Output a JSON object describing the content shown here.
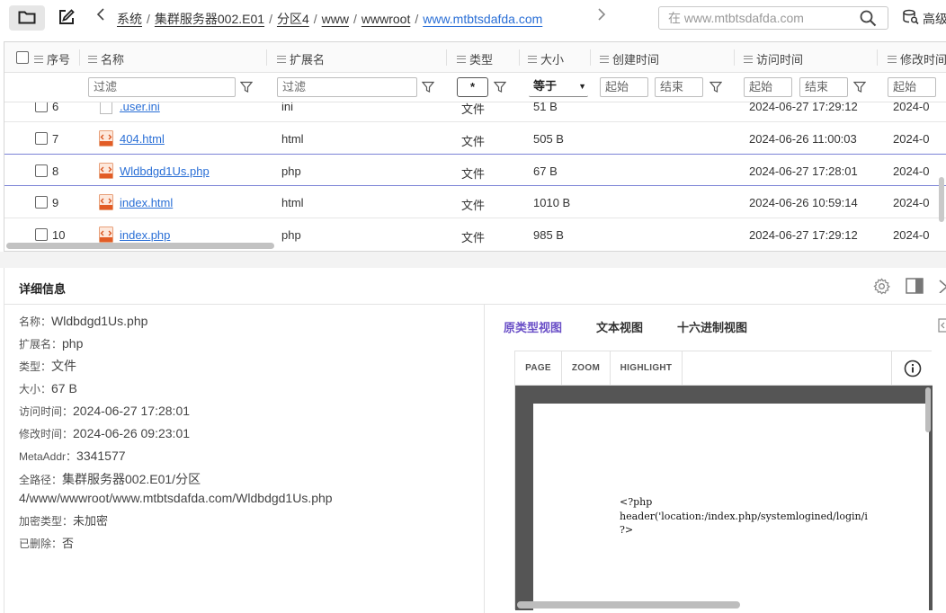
{
  "toolbar": {
    "folder_icon": "folder-icon",
    "edit_icon": "edit-icon",
    "back_icon": "chevron-left-icon",
    "forward_icon": "chevron-right-icon"
  },
  "breadcrumb": [
    "系统",
    "集群服务器002.E01",
    "分区4",
    "www",
    "wwwroot",
    "www.mtbtsdafda.com"
  ],
  "search": {
    "placeholder": "在 www.mtbtsdafda.com"
  },
  "advanced_label": "高级",
  "table": {
    "headers": {
      "index": "序号",
      "name": "名称",
      "ext": "扩展名",
      "type": "类型",
      "size": "大小",
      "created": "创建时间",
      "accessed": "访问时间",
      "modified": "修改时间"
    },
    "filters": {
      "name": "过滤",
      "ext": "过滤",
      "type": "*",
      "size_op": "等于",
      "created_start": "起始",
      "created_end": "结束",
      "accessed_start": "起始",
      "accessed_end": "结束",
      "modified_start": "起始"
    },
    "rows": [
      {
        "index": "6",
        "name": ".user.ini",
        "ext": "ini",
        "type": "文件",
        "size": "51 B",
        "accessed": "2024-06-27 17:29:12",
        "modified": "2024-0",
        "icon": "file-icon"
      },
      {
        "index": "7",
        "name": "404.html",
        "ext": "html",
        "type": "文件",
        "size": "505 B",
        "accessed": "2024-06-26 11:00:03",
        "modified": "2024-0",
        "icon": "html-file-icon"
      },
      {
        "index": "8",
        "name": "Wldbdgd1Us.php",
        "ext": "php",
        "type": "文件",
        "size": "67 B",
        "accessed": "2024-06-27 17:28:01",
        "modified": "2024-0",
        "icon": "html-file-icon"
      },
      {
        "index": "9",
        "name": "index.html",
        "ext": "html",
        "type": "文件",
        "size": "1010 B",
        "accessed": "2024-06-26 10:59:14",
        "modified": "2024-0",
        "icon": "html-file-icon"
      },
      {
        "index": "10",
        "name": "index.php",
        "ext": "php",
        "type": "文件",
        "size": "985 B",
        "accessed": "2024-06-27 17:29:12",
        "modified": "2024-0",
        "icon": "html-file-icon"
      }
    ]
  },
  "details": {
    "title": "详细信息",
    "fields": [
      {
        "label": "名称：",
        "value": "Wldbdgd1Us.php"
      },
      {
        "label": "扩展名：",
        "value": "php"
      },
      {
        "label": "类型：",
        "value": "文件"
      },
      {
        "label": "大小：",
        "value": "67 B"
      },
      {
        "label": "访问时间：",
        "value": "2024-06-27 17:28:01"
      },
      {
        "label": "修改时间：",
        "value": "2024-06-26 09:23:01"
      },
      {
        "label": "MetaAddr：",
        "value": "3341577"
      }
    ],
    "path_label": "全路径：",
    "path_value": "集群服务器002.E01/分区4/www/wwwroot/www.mtbtsdafda.com/Wldbdgd1Us.php",
    "encrypt_label": "加密类型：",
    "encrypt_value": "未加密",
    "deleted_label": "已删除：",
    "deleted_value": "否"
  },
  "viewer": {
    "tabs": [
      "原类型视图",
      "文本视图",
      "十六进制视图"
    ],
    "active_tab": 0,
    "buttons": [
      "PAGE",
      "ZOOM",
      "HIGHLIGHT"
    ],
    "code_lines": [
      "<?php",
      "header('location:/index.php/systemlogined/login/i",
      "?>"
    ]
  },
  "colors": {
    "accent": "#6a4fc7",
    "link": "#2a6fd6"
  }
}
